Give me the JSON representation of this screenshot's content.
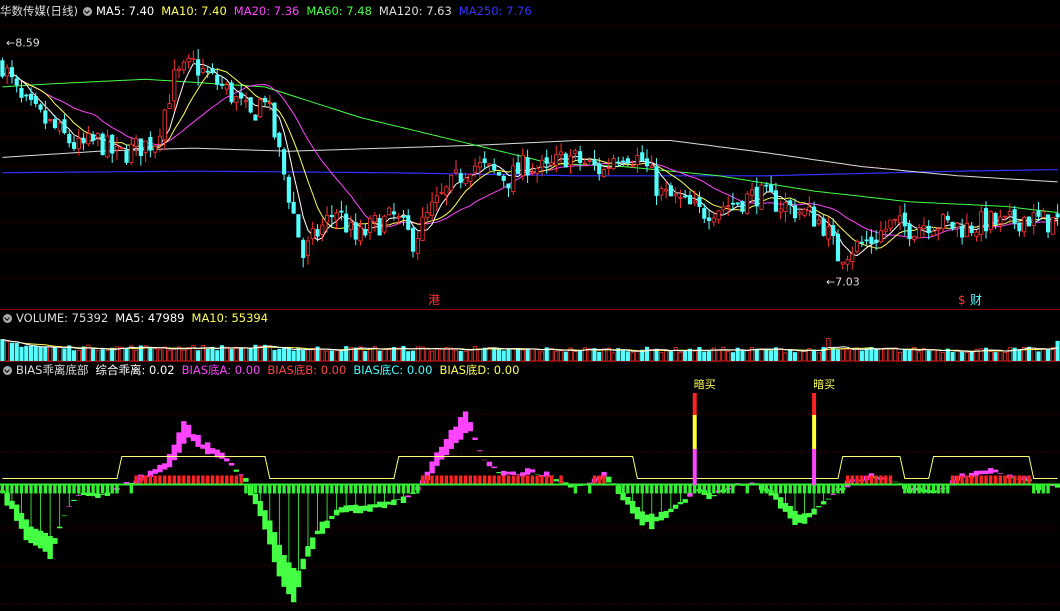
{
  "chart_data": [
    {
      "type": "candlestick",
      "panel": "price",
      "title": "华数传媒(日线)",
      "indicators": [
        {
          "label": "MA5: 7.40",
          "color": "#ffffff"
        },
        {
          "label": "MA10: 7.40",
          "color": "#ffff55"
        },
        {
          "label": "MA20: 7.36",
          "color": "#ff44ff"
        },
        {
          "label": "MA60: 7.48",
          "color": "#44ff44"
        },
        {
          "label": "MA120: 7.63",
          "color": "#dddddd"
        },
        {
          "label": "MA250: 7.76",
          "color": "#3333ff"
        }
      ],
      "ylim": [
        6.85,
        8.75
      ],
      "annotations": {
        "high": "8.59",
        "low": "7.03",
        "marker_left": "港",
        "marker_right_1": "$",
        "marker_right_2": "财"
      },
      "close_anchors": [
        [
          0,
          8.45
        ],
        [
          4,
          8.2
        ],
        [
          8,
          8.1
        ],
        [
          12,
          8.0
        ],
        [
          16,
          7.9
        ],
        [
          20,
          7.95
        ],
        [
          24,
          7.85
        ],
        [
          28,
          7.9
        ],
        [
          32,
          7.95
        ],
        [
          36,
          8.35
        ],
        [
          40,
          8.45
        ],
        [
          44,
          8.35
        ],
        [
          48,
          8.25
        ],
        [
          52,
          8.1
        ],
        [
          55,
          8.25
        ],
        [
          60,
          7.6
        ],
        [
          63,
          7.2
        ],
        [
          66,
          7.35
        ],
        [
          70,
          7.5
        ],
        [
          74,
          7.3
        ],
        [
          78,
          7.4
        ],
        [
          82,
          7.45
        ],
        [
          86,
          7.3
        ],
        [
          90,
          7.5
        ],
        [
          94,
          7.65
        ],
        [
          98,
          7.8
        ],
        [
          102,
          7.75
        ],
        [
          106,
          7.7
        ],
        [
          110,
          7.8
        ],
        [
          114,
          7.75
        ],
        [
          118,
          7.85
        ],
        [
          122,
          7.8
        ],
        [
          126,
          7.75
        ],
        [
          128,
          7.85
        ],
        [
          130,
          7.88
        ],
        [
          134,
          7.82
        ],
        [
          138,
          7.6
        ],
        [
          142,
          7.55
        ],
        [
          146,
          7.48
        ],
        [
          150,
          7.52
        ],
        [
          154,
          7.55
        ],
        [
          158,
          7.6
        ],
        [
          162,
          7.55
        ],
        [
          166,
          7.5
        ],
        [
          170,
          7.45
        ],
        [
          172,
          7.4
        ],
        [
          175,
          7.2
        ],
        [
          178,
          7.25
        ],
        [
          182,
          7.3
        ],
        [
          186,
          7.4
        ],
        [
          190,
          7.38
        ],
        [
          194,
          7.42
        ],
        [
          198,
          7.4
        ],
        [
          202,
          7.38
        ],
        [
          206,
          7.42
        ],
        [
          210,
          7.4
        ],
        [
          214,
          7.45
        ],
        [
          218,
          7.42
        ],
        [
          221,
          7.42
        ]
      ],
      "ma_lines": {
        "MA120": [
          [
            0,
            7.84
          ],
          [
            20,
            7.88
          ],
          [
            40,
            7.9
          ],
          [
            60,
            7.88
          ],
          [
            80,
            7.9
          ],
          [
            100,
            7.92
          ],
          [
            120,
            7.95
          ],
          [
            140,
            7.95
          ],
          [
            160,
            7.87
          ],
          [
            180,
            7.78
          ],
          [
            200,
            7.72
          ],
          [
            221,
            7.68
          ]
        ],
        "MA250": [
          [
            0,
            7.74
          ],
          [
            40,
            7.75
          ],
          [
            80,
            7.74
          ],
          [
            120,
            7.72
          ],
          [
            160,
            7.72
          ],
          [
            200,
            7.75
          ],
          [
            221,
            7.76
          ]
        ],
        "MA60": [
          [
            0,
            8.3
          ],
          [
            10,
            8.32
          ],
          [
            30,
            8.35
          ],
          [
            55,
            8.3
          ],
          [
            75,
            8.1
          ],
          [
            95,
            7.95
          ],
          [
            115,
            7.8
          ],
          [
            130,
            7.78
          ],
          [
            150,
            7.72
          ],
          [
            170,
            7.62
          ],
          [
            190,
            7.55
          ],
          [
            210,
            7.52
          ],
          [
            221,
            7.48
          ]
        ]
      }
    },
    {
      "type": "bar",
      "panel": "volume",
      "title": "VOLUME: 75392",
      "indicators": [
        {
          "label": "MA5: 47989",
          "color": "#ffffff"
        },
        {
          "label": "MA10: 55394",
          "color": "#ffff55"
        }
      ],
      "ylim": [
        0,
        130000
      ]
    },
    {
      "type": "area",
      "panel": "bias",
      "title": "BIAS乖离底部",
      "indicators": [
        {
          "label": "综合乖离: 0.02",
          "color": "#ffffff"
        },
        {
          "label": "BIAS底A: 0.00",
          "color": "#ff44ff"
        },
        {
          "label": "BIAS底B: 0.00",
          "color": "#ff4444"
        },
        {
          "label": "BIAS底C: 0.00",
          "color": "#44ffff"
        },
        {
          "label": "BIAS底D: 0.00",
          "color": "#ffff55"
        }
      ],
      "signal_label": "暗买",
      "signal_days": [
        145,
        170
      ],
      "ylim": [
        -12,
        10
      ],
      "anchors": [
        [
          0,
          -1
        ],
        [
          5,
          -5
        ],
        [
          10,
          -7
        ],
        [
          13,
          -3
        ],
        [
          16,
          -1
        ],
        [
          22,
          -1
        ],
        [
          28,
          0.5
        ],
        [
          34,
          2
        ],
        [
          38,
          6
        ],
        [
          42,
          4
        ],
        [
          46,
          3
        ],
        [
          50,
          1
        ],
        [
          52,
          -1
        ],
        [
          55,
          -4
        ],
        [
          58,
          -9
        ],
        [
          61,
          -11
        ],
        [
          63,
          -8
        ],
        [
          66,
          -5
        ],
        [
          70,
          -3
        ],
        [
          76,
          -2.5
        ],
        [
          82,
          -2
        ],
        [
          86,
          -1
        ],
        [
          90,
          2
        ],
        [
          94,
          5
        ],
        [
          97,
          7
        ],
        [
          100,
          3
        ],
        [
          103,
          1.5
        ],
        [
          106,
          1
        ],
        [
          110,
          1.5
        ],
        [
          114,
          1
        ],
        [
          118,
          0
        ],
        [
          122,
          0
        ],
        [
          126,
          1
        ],
        [
          130,
          -1.5
        ],
        [
          133,
          -3.5
        ],
        [
          136,
          -4
        ],
        [
          139,
          -3
        ],
        [
          142,
          -2
        ],
        [
          145,
          -0.5
        ],
        [
          148,
          -1.5
        ],
        [
          151,
          -0.5
        ],
        [
          154,
          0
        ],
        [
          158,
          0
        ],
        [
          162,
          -1.5
        ],
        [
          165,
          -3.5
        ],
        [
          168,
          -4
        ],
        [
          171,
          -2
        ],
        [
          174,
          -1
        ],
        [
          178,
          0.5
        ],
        [
          182,
          1
        ],
        [
          186,
          0.5
        ],
        [
          190,
          -0.5
        ],
        [
          194,
          -1
        ],
        [
          198,
          0
        ],
        [
          202,
          1
        ],
        [
          206,
          1.5
        ],
        [
          210,
          1
        ],
        [
          214,
          0.5
        ],
        [
          218,
          -0.5
        ],
        [
          221,
          0
        ]
      ]
    }
  ]
}
